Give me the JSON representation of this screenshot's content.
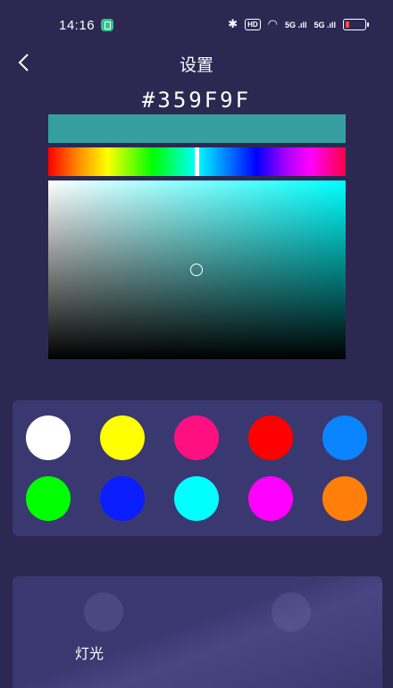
{
  "status_bar": {
    "time": "14:16",
    "bluetooth_icon": "✱",
    "hd_badge": "HD",
    "wifi_icon": "◠",
    "signal_1": "5G .ıll",
    "signal_2": "5G .ıll"
  },
  "header": {
    "title": "设置"
  },
  "picker": {
    "hex_value": "#359F9F",
    "current_color": "#359F9F",
    "hue_fraction": 0.5
  },
  "swatches": [
    {
      "name": "white",
      "color": "#FFFFFF"
    },
    {
      "name": "yellow",
      "color": "#FFFF00"
    },
    {
      "name": "pink",
      "color": "#FF1080"
    },
    {
      "name": "red",
      "color": "#FF0000"
    },
    {
      "name": "blue-light",
      "color": "#0A84FF"
    },
    {
      "name": "green",
      "color": "#00FF00"
    },
    {
      "name": "blue",
      "color": "#0A1EFF"
    },
    {
      "name": "cyan",
      "color": "#00FFFF"
    },
    {
      "name": "magenta",
      "color": "#FF00FF"
    },
    {
      "name": "orange",
      "color": "#FF7F0A"
    }
  ],
  "mode": {
    "label": "灯光"
  }
}
